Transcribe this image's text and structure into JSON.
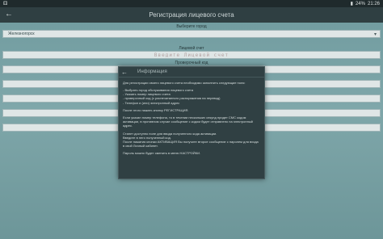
{
  "status_bar": {
    "left": "⚃",
    "battery": "24%",
    "time": "21:26"
  },
  "app_bar": {
    "back_glyph": "←",
    "title": "Регистрация лицевого счета"
  },
  "form": {
    "city_label": "Выберите город",
    "city_value": "Железногорск",
    "account_label": "Лицевой счет",
    "account_placeholder": "Введите Лицевой счет",
    "code_label": "Проверочный код"
  },
  "dialog": {
    "back_glyph": "←",
    "title": "Информация",
    "intro": "Для регистрации своего лицевого счета необходимо заполнить следующие поля:",
    "list": [
      "- Выбрать город обслуживания лицевого счета",
      "- Указать номер лицевого счета",
      "- проверочный код (с распечатанного распоряжения на перевод)",
      "- Телефон и (или) электронный адрес"
    ],
    "press": "После этого нажать кнопку РЕГИСТРАЦИЯ.",
    "sms": "Если указан номер телефона, то в течении нескольких секунд придет СМС кодом активации, в противном случае сообщение с кодом будет отправлено на электронный адрес.",
    "code_lines": [
      "Станет доступно поле для ввода полученного кода активации.",
      "Введите в него полученный код.",
      "После нажатия кнопки АКТИВАЦИЯ Вы получите второе сообщение с паролем для входа в свой Личный кабинет."
    ],
    "password": "Пароль можно будет сменить в меню НАСТРОЙКИ."
  }
}
